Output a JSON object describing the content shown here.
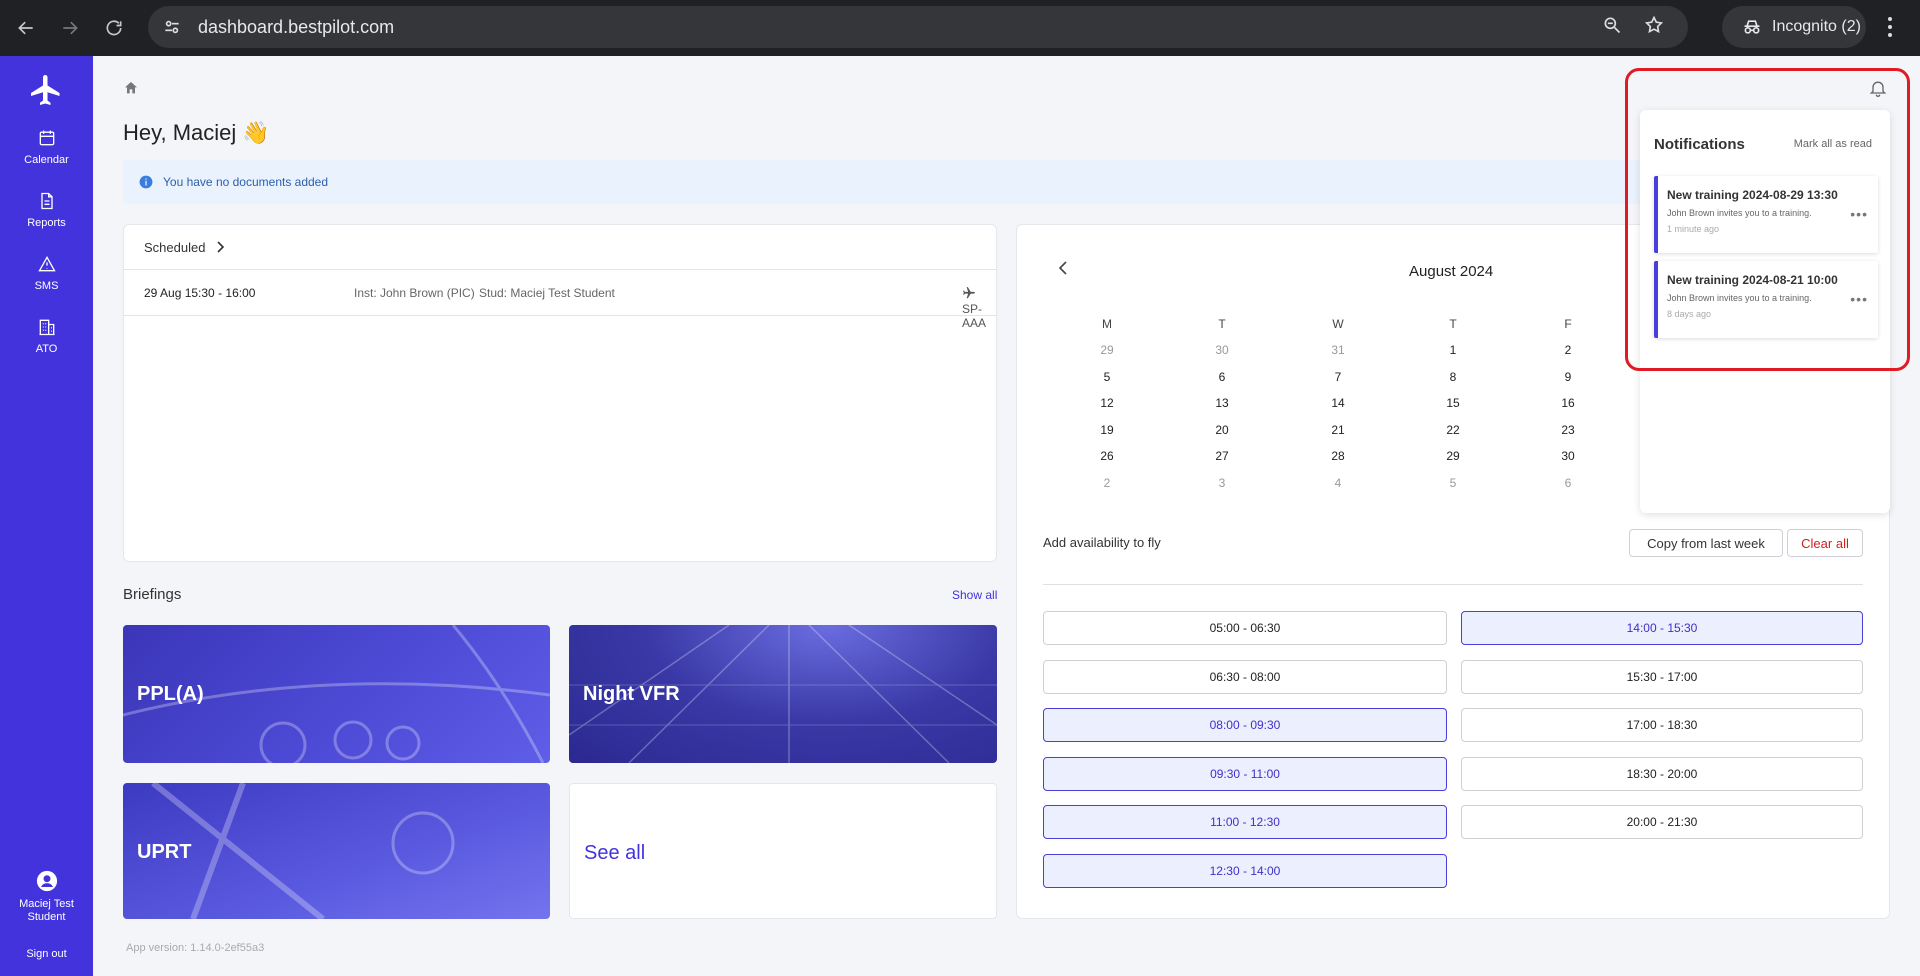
{
  "browser": {
    "url": "dashboard.bestpilot.com",
    "incognito_label": "Incognito (2)"
  },
  "sidebar": {
    "items": [
      {
        "label": "Calendar",
        "icon": "calendar-icon"
      },
      {
        "label": "Reports",
        "icon": "document-icon"
      },
      {
        "label": "SMS",
        "icon": "warning-icon"
      },
      {
        "label": "ATO",
        "icon": "building-icon"
      }
    ],
    "user": {
      "name_line1": "Maciej Test",
      "name_line2": "Student"
    },
    "sign_out": "Sign out"
  },
  "main": {
    "greeting": "Hey, Maciej 👋",
    "alert": "You have no documents added",
    "scheduled": {
      "title": "Scheduled",
      "rows": [
        {
          "time": "29 Aug 15:30 - 16:00",
          "instructor": "Inst: John Brown (PIC)",
          "student": "Stud: Maciej Test Student",
          "aircraft": "SP-AAA"
        }
      ]
    },
    "briefings": {
      "title": "Briefings",
      "show_all": "Show all",
      "tiles": [
        "PPL(A)",
        "Night VFR",
        "UPRT"
      ],
      "see_all": "See all"
    },
    "version": "App version: 1.14.0-2ef55a3"
  },
  "calendar": {
    "month": "August 2024",
    "weekdays": [
      "M",
      "T",
      "W",
      "T",
      "F"
    ],
    "weeks": [
      [
        {
          "d": "29",
          "m": true
        },
        {
          "d": "30",
          "m": true
        },
        {
          "d": "31",
          "m": true
        },
        {
          "d": "1"
        },
        {
          "d": "2"
        }
      ],
      [
        {
          "d": "5"
        },
        {
          "d": "6"
        },
        {
          "d": "7"
        },
        {
          "d": "8"
        },
        {
          "d": "9"
        }
      ],
      [
        {
          "d": "12"
        },
        {
          "d": "13"
        },
        {
          "d": "14"
        },
        {
          "d": "15"
        },
        {
          "d": "16"
        }
      ],
      [
        {
          "d": "19"
        },
        {
          "d": "20"
        },
        {
          "d": "21"
        },
        {
          "d": "22"
        },
        {
          "d": "23"
        }
      ],
      [
        {
          "d": "26"
        },
        {
          "d": "27"
        },
        {
          "d": "28"
        },
        {
          "d": "29"
        },
        {
          "d": "30"
        }
      ],
      [
        {
          "d": "2",
          "m": true
        },
        {
          "d": "3",
          "m": true
        },
        {
          "d": "4",
          "m": true
        },
        {
          "d": "5",
          "m": true
        },
        {
          "d": "6",
          "m": true
        }
      ]
    ],
    "availability": {
      "label": "Add availability to fly",
      "copy_button": "Copy from last week",
      "clear_button": "Clear all",
      "slots_left": [
        {
          "t": "05:00 - 06:30",
          "selected": false
        },
        {
          "t": "06:30 - 08:00",
          "selected": false
        },
        {
          "t": "08:00 - 09:30",
          "selected": true
        },
        {
          "t": "09:30 - 11:00",
          "selected": true
        },
        {
          "t": "11:00 - 12:30",
          "selected": true
        },
        {
          "t": "12:30 - 14:00",
          "selected": true
        }
      ],
      "slots_right": [
        {
          "t": "14:00 - 15:30",
          "selected": true
        },
        {
          "t": "15:30 - 17:00",
          "selected": false
        },
        {
          "t": "17:00 - 18:30",
          "selected": false
        },
        {
          "t": "18:30 - 20:00",
          "selected": false
        },
        {
          "t": "20:00 - 21:30",
          "selected": false
        }
      ]
    }
  },
  "notifications": {
    "title": "Notifications",
    "mark_all": "Mark all as read",
    "items": [
      {
        "title": "New training 2024-08-29 13:30",
        "body": "John Brown invites you to a training.",
        "time": "1 minute ago"
      },
      {
        "title": "New training 2024-08-21 10:00",
        "body": "John Brown invites you to a training.",
        "time": "8 days ago"
      }
    ]
  },
  "colors": {
    "brand": "#4333dd",
    "highlight": "#e01b24"
  }
}
